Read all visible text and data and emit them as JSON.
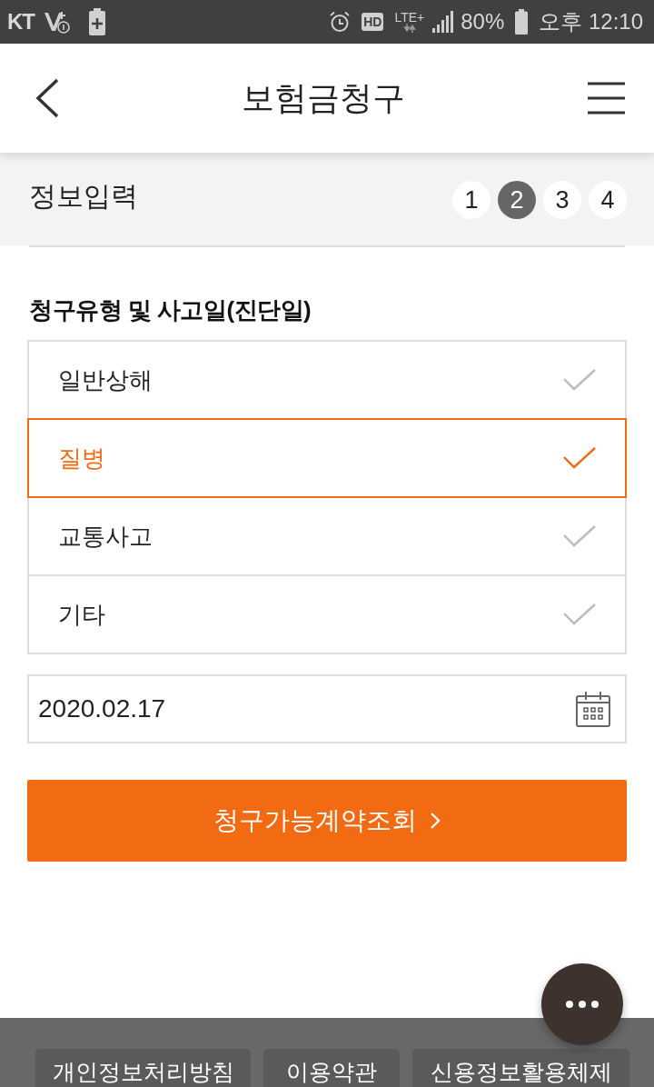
{
  "status_bar": {
    "carrier": "KT",
    "hd_label": "HD",
    "network_type": "LTE+",
    "battery_percent": "80%",
    "time": "오후 12:10"
  },
  "header": {
    "title": "보험금청구"
  },
  "progress": {
    "title": "정보입력",
    "steps": [
      {
        "label": "1",
        "selected": false
      },
      {
        "label": "2",
        "selected": true
      },
      {
        "label": "3",
        "selected": false
      },
      {
        "label": "4",
        "selected": false
      }
    ]
  },
  "claim_form": {
    "section_title": "청구유형 및 사고일(진단일)",
    "claim_types": [
      {
        "label": "일반상해",
        "selected": false
      },
      {
        "label": "질병",
        "selected": true
      },
      {
        "label": "교통사고",
        "selected": false
      },
      {
        "label": "기타",
        "selected": false
      }
    ],
    "date_field": {
      "value": "2020.02.17"
    },
    "submit_button": {
      "label": "청구가능계약조회"
    }
  },
  "footer": {
    "links": [
      "개인정보처리방침",
      "이용약관",
      "신용정보활용체제"
    ]
  }
}
